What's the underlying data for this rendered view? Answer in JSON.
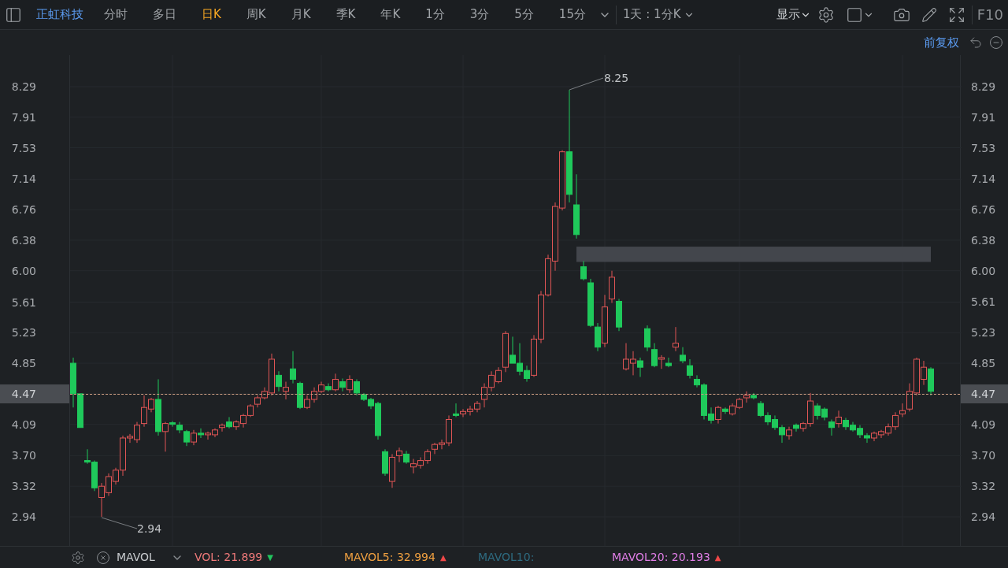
{
  "toolbar": {
    "stock_name": "正虹科技",
    "periods": [
      {
        "label": "分时",
        "selected": false
      },
      {
        "label": "多日",
        "selected": false
      },
      {
        "label": "日K",
        "selected": true
      },
      {
        "label": "周K",
        "selected": false
      },
      {
        "label": "月K",
        "selected": false
      },
      {
        "label": "季K",
        "selected": false
      },
      {
        "label": "年K",
        "selected": false
      },
      {
        "label": "1分",
        "selected": false
      },
      {
        "label": "3分",
        "selected": false
      },
      {
        "label": "5分",
        "selected": false
      },
      {
        "label": "15分",
        "selected": false
      }
    ],
    "range_dropdown": "1天 : 1分K",
    "display_menu": "显示",
    "f10": "F10"
  },
  "adjust": "前复权",
  "chart": {
    "y_axis_right": [
      {
        "label": "8.29",
        "current": false
      },
      {
        "label": "7.91",
        "current": false
      },
      {
        "label": "7.53",
        "current": false
      },
      {
        "label": "7.14",
        "current": false
      },
      {
        "label": "6.76",
        "current": false
      },
      {
        "label": "6.38",
        "current": false
      },
      {
        "label": "6.00",
        "current": false
      },
      {
        "label": "5.61",
        "current": false
      },
      {
        "label": "5.23",
        "current": false
      },
      {
        "label": "4.85",
        "current": false
      },
      {
        "label": "4.47",
        "current": true
      },
      {
        "label": "4.09",
        "current": false
      },
      {
        "label": "3.70",
        "current": false
      },
      {
        "label": "3.32",
        "current": false
      },
      {
        "label": "2.94",
        "current": false
      }
    ],
    "high_label": "8.25",
    "low_label": "2.94",
    "chart_data": {
      "type": "candlestick",
      "ylim": [
        2.94,
        8.29
      ],
      "yticks": [
        {
          "value": 8.29,
          "label": "8.29"
        },
        {
          "value": 7.91,
          "label": "7.91"
        },
        {
          "value": 7.53,
          "label": "7.53"
        },
        {
          "value": 7.14,
          "label": "7.14"
        },
        {
          "value": 6.76,
          "label": "6.76"
        },
        {
          "value": 6.38,
          "label": "6.38"
        },
        {
          "value": 6.0,
          "label": "6.00"
        },
        {
          "value": 5.61,
          "label": "5.61"
        },
        {
          "value": 5.23,
          "label": "5.23"
        },
        {
          "value": 4.85,
          "label": "4.85"
        },
        {
          "value": 4.47,
          "label": "4.47"
        },
        {
          "value": 4.09,
          "label": "4.09"
        },
        {
          "value": 3.7,
          "label": "3.70"
        },
        {
          "value": 3.32,
          "label": "3.32"
        },
        {
          "value": 2.94,
          "label": "2.94"
        }
      ],
      "ref_lines": [
        {
          "axis": "y",
          "value": 4.47
        }
      ],
      "bands": [
        {
          "axis": "y",
          "from": 6.11,
          "to": 6.3
        }
      ],
      "grid": true,
      "categories": [
        null,
        null,
        null,
        null,
        null,
        null,
        null,
        null,
        null,
        null,
        null,
        null,
        null,
        null,
        null,
        null,
        null,
        null,
        null,
        null,
        null,
        null,
        null,
        null,
        null,
        null,
        null,
        null,
        null,
        null,
        null,
        null,
        null,
        null,
        null,
        null,
        null,
        null,
        null,
        null,
        null,
        null,
        null,
        null,
        null,
        null,
        null,
        null,
        null,
        null,
        null,
        null,
        null,
        null,
        null,
        null,
        null,
        null,
        null,
        null,
        null,
        null,
        null,
        null,
        null,
        null,
        null,
        null,
        null,
        null,
        null,
        null,
        null,
        null,
        null,
        null,
        null,
        null,
        null,
        null,
        null,
        null,
        null,
        null,
        null,
        null,
        null,
        null,
        null,
        null,
        null,
        null,
        null,
        null,
        null,
        null,
        null,
        null,
        null,
        null,
        null,
        null,
        null,
        null,
        null,
        null,
        null,
        null,
        null,
        null,
        null,
        null,
        null,
        null,
        null,
        null,
        null,
        null,
        null,
        null,
        null,
        null
      ],
      "ohlc": [
        [
          4.85,
          4.92,
          4.3,
          4.47
        ],
        [
          4.47,
          4.47,
          4.05,
          4.05
        ],
        [
          3.64,
          3.78,
          3.6,
          3.62
        ],
        [
          3.62,
          3.64,
          3.26,
          3.3
        ],
        [
          3.18,
          3.36,
          2.94,
          3.32
        ],
        [
          3.24,
          3.48,
          3.2,
          3.44
        ],
        [
          3.38,
          3.55,
          3.34,
          3.52
        ],
        [
          3.52,
          3.95,
          3.45,
          3.92
        ],
        [
          3.92,
          3.97,
          3.86,
          3.94
        ],
        [
          3.9,
          4.12,
          3.86,
          4.08
        ],
        [
          4.1,
          4.45,
          4.06,
          4.3
        ],
        [
          4.28,
          4.42,
          4.24,
          4.4
        ],
        [
          4.4,
          4.65,
          3.95,
          4.0
        ],
        [
          4.0,
          4.12,
          3.75,
          4.1
        ],
        [
          4.11,
          4.13,
          4.06,
          4.09
        ],
        [
          4.08,
          4.12,
          3.98,
          4.02
        ],
        [
          4.0,
          4.02,
          3.82,
          3.87
        ],
        [
          3.87,
          4.02,
          3.83,
          3.98
        ],
        [
          3.98,
          4.04,
          3.92,
          3.96
        ],
        [
          3.96,
          4.0,
          3.9,
          3.98
        ],
        [
          3.96,
          4.04,
          3.93,
          4.02
        ],
        [
          4.05,
          4.1,
          4.0,
          4.08
        ],
        [
          4.12,
          4.18,
          4.04,
          4.06
        ],
        [
          4.06,
          4.14,
          4.02,
          4.12
        ],
        [
          4.1,
          4.22,
          4.05,
          4.2
        ],
        [
          4.2,
          4.34,
          4.18,
          4.32
        ],
        [
          4.34,
          4.45,
          4.3,
          4.42
        ],
        [
          4.42,
          4.55,
          4.4,
          4.5
        ],
        [
          4.48,
          4.97,
          4.45,
          4.9
        ],
        [
          4.7,
          4.75,
          4.5,
          4.56
        ],
        [
          4.5,
          4.62,
          4.4,
          4.55
        ],
        [
          4.78,
          5.0,
          4.6,
          4.65
        ],
        [
          4.6,
          4.62,
          4.28,
          4.3
        ],
        [
          4.3,
          4.45,
          4.28,
          4.4
        ],
        [
          4.4,
          4.55,
          4.36,
          4.5
        ],
        [
          4.5,
          4.62,
          4.48,
          4.58
        ],
        [
          4.56,
          4.6,
          4.5,
          4.52
        ],
        [
          4.52,
          4.72,
          4.5,
          4.65
        ],
        [
          4.62,
          4.66,
          4.5,
          4.55
        ],
        [
          4.52,
          4.7,
          4.48,
          4.65
        ],
        [
          4.62,
          4.65,
          4.45,
          4.48
        ],
        [
          4.46,
          4.48,
          4.38,
          4.4
        ],
        [
          4.4,
          4.42,
          4.28,
          4.32
        ],
        [
          4.35,
          4.37,
          3.9,
          3.95
        ],
        [
          3.75,
          3.78,
          3.45,
          3.48
        ],
        [
          3.38,
          3.72,
          3.3,
          3.68
        ],
        [
          3.7,
          3.8,
          3.62,
          3.76
        ],
        [
          3.72,
          3.76,
          3.6,
          3.62
        ],
        [
          3.56,
          3.66,
          3.48,
          3.6
        ],
        [
          3.58,
          3.68,
          3.54,
          3.64
        ],
        [
          3.64,
          3.78,
          3.6,
          3.75
        ],
        [
          3.78,
          3.86,
          3.72,
          3.84
        ],
        [
          3.84,
          3.9,
          3.78,
          3.86
        ],
        [
          3.86,
          4.2,
          3.82,
          4.15
        ],
        [
          4.22,
          4.35,
          4.18,
          4.2
        ],
        [
          4.22,
          4.28,
          4.18,
          4.25
        ],
        [
          4.25,
          4.32,
          4.2,
          4.28
        ],
        [
          4.28,
          4.38,
          4.24,
          4.35
        ],
        [
          4.4,
          4.6,
          4.3,
          4.55
        ],
        [
          4.55,
          4.75,
          4.5,
          4.7
        ],
        [
          4.62,
          4.8,
          4.6,
          4.76
        ],
        [
          4.8,
          5.25,
          4.74,
          5.22
        ],
        [
          4.95,
          5.18,
          4.85,
          4.85
        ],
        [
          4.85,
          5.1,
          4.7,
          4.75
        ],
        [
          4.76,
          4.82,
          4.62,
          4.66
        ],
        [
          4.7,
          5.2,
          4.68,
          5.15
        ],
        [
          5.15,
          5.75,
          5.1,
          5.7
        ],
        [
          5.7,
          6.2,
          5.68,
          6.15
        ],
        [
          6.12,
          6.85,
          6.0,
          6.8
        ],
        [
          6.78,
          7.5,
          6.75,
          7.48
        ],
        [
          7.48,
          8.25,
          6.85,
          6.95
        ],
        [
          6.82,
          7.2,
          6.4,
          6.45
        ],
        [
          6.05,
          6.12,
          5.88,
          5.9
        ],
        [
          5.85,
          5.9,
          5.3,
          5.32
        ],
        [
          5.3,
          5.35,
          5.0,
          5.05
        ],
        [
          5.1,
          5.7,
          5.05,
          5.55
        ],
        [
          5.65,
          6.0,
          5.6,
          5.92
        ],
        [
          5.62,
          5.65,
          5.25,
          5.3
        ],
        [
          4.78,
          5.1,
          4.76,
          4.9
        ],
        [
          4.85,
          5.0,
          4.7,
          4.9
        ],
        [
          4.88,
          4.92,
          4.68,
          4.8
        ],
        [
          5.28,
          5.32,
          5.0,
          5.05
        ],
        [
          5.02,
          5.1,
          4.8,
          4.82
        ],
        [
          4.9,
          4.95,
          4.78,
          4.92
        ],
        [
          4.85,
          4.92,
          4.8,
          4.82
        ],
        [
          5.05,
          5.3,
          5.0,
          5.1
        ],
        [
          4.95,
          5.05,
          4.85,
          4.88
        ],
        [
          4.82,
          4.9,
          4.66,
          4.7
        ],
        [
          4.65,
          4.7,
          4.55,
          4.58
        ],
        [
          4.58,
          4.6,
          4.15,
          4.2
        ],
        [
          4.22,
          4.3,
          4.1,
          4.14
        ],
        [
          4.15,
          4.32,
          4.1,
          4.3
        ],
        [
          4.28,
          4.3,
          4.22,
          4.25
        ],
        [
          4.22,
          4.35,
          4.2,
          4.32
        ],
        [
          4.3,
          4.42,
          4.28,
          4.4
        ],
        [
          4.42,
          4.5,
          4.36,
          4.45
        ],
        [
          4.45,
          4.48,
          4.4,
          4.42
        ],
        [
          4.35,
          4.38,
          4.18,
          4.2
        ],
        [
          4.2,
          4.24,
          4.08,
          4.12
        ],
        [
          4.15,
          4.2,
          4.02,
          4.05
        ],
        [
          4.05,
          4.08,
          3.86,
          3.96
        ],
        [
          3.95,
          4.06,
          3.9,
          4.02
        ],
        [
          4.08,
          4.1,
          4.0,
          4.04
        ],
        [
          4.04,
          4.12,
          4.0,
          4.1
        ],
        [
          4.1,
          4.48,
          4.06,
          4.38
        ],
        [
          4.32,
          4.35,
          4.15,
          4.2
        ],
        [
          4.28,
          4.3,
          4.14,
          4.18
        ],
        [
          4.12,
          4.15,
          3.95,
          4.05
        ],
        [
          4.1,
          4.26,
          4.05,
          4.18
        ],
        [
          4.14,
          4.17,
          4.02,
          4.06
        ],
        [
          4.08,
          4.12,
          4.0,
          4.02
        ],
        [
          4.04,
          4.08,
          3.92,
          3.96
        ],
        [
          3.95,
          3.98,
          3.86,
          3.92
        ],
        [
          3.92,
          4.0,
          3.88,
          3.98
        ],
        [
          3.96,
          4.02,
          3.92,
          4.0
        ],
        [
          3.98,
          4.1,
          3.95,
          4.06
        ],
        [
          4.06,
          4.24,
          4.02,
          4.2
        ],
        [
          4.22,
          4.35,
          4.18,
          4.26
        ],
        [
          4.28,
          4.6,
          4.25,
          4.5
        ],
        [
          4.48,
          4.92,
          4.45,
          4.9
        ],
        [
          4.65,
          4.88,
          4.58,
          4.8
        ],
        [
          4.78,
          4.8,
          4.45,
          4.5
        ]
      ]
    }
  },
  "indicator": {
    "name": "MAVOL",
    "items": [
      {
        "label": "VOL:",
        "value": "21.899",
        "color": "#f07a7a",
        "arrow": {
          "glyph": "▼",
          "color": "#22c55e"
        }
      },
      {
        "label": "MAVOL5:",
        "value": "32.994",
        "color": "#f0a040",
        "arrow": {
          "glyph": "▲",
          "color": "#f04848"
        }
      },
      {
        "label": "MAVOL10:",
        "color": "#2e6b80"
      },
      {
        "label": "MAVOL20:",
        "value": "20.193",
        "color": "#e07ee6",
        "arrow": {
          "glyph": "▲",
          "color": "#f04848"
        }
      }
    ]
  }
}
